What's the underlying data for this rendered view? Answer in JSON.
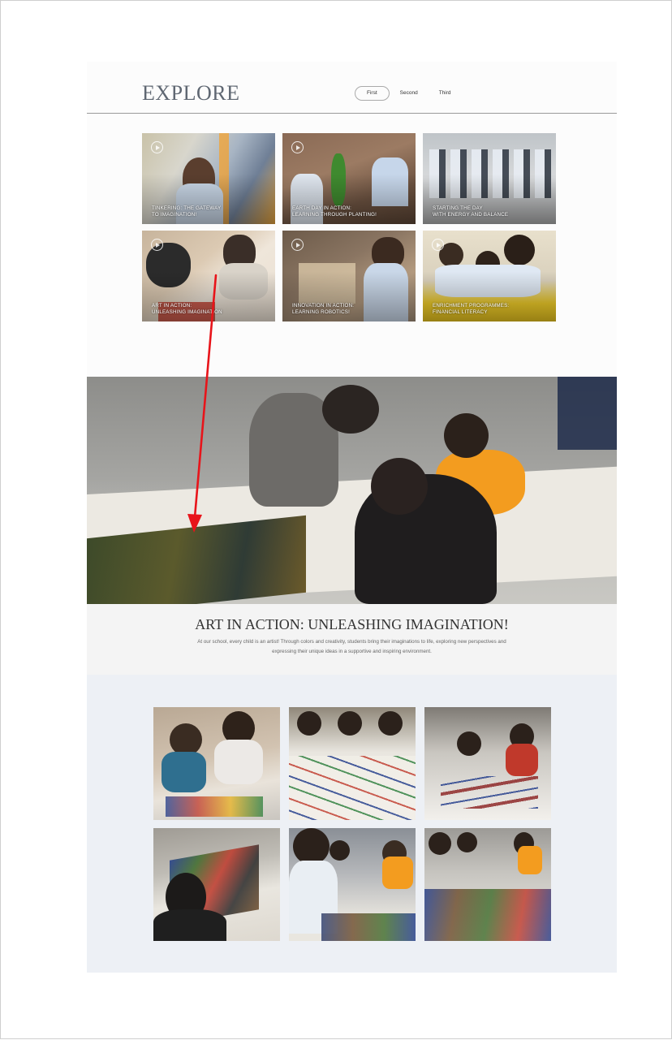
{
  "header": {
    "title": "EXPLORE",
    "tabs": [
      {
        "label": "First",
        "active": true
      },
      {
        "label": "Second",
        "active": false
      },
      {
        "label": "Third",
        "active": false
      }
    ]
  },
  "cards": [
    {
      "line1": "TINKERING: THE GATEWAY",
      "line2": "TO IMAGINATION!",
      "icon": "play-icon"
    },
    {
      "line1": "EARTH DAY IN ACTION:",
      "line2": "LEARNING THROUGH PLANTING!",
      "icon": "play-icon"
    },
    {
      "line1": "STARTING THE DAY",
      "line2": "WITH ENERGY AND BALANCE",
      "icon": "play-icon"
    },
    {
      "line1": "ART IN ACTION:",
      "line2": "UNLEASHING IMAGINATION",
      "icon": "play-icon"
    },
    {
      "line1": "INNOVATION IN ACTION:",
      "line2": "LEARNING ROBOTICS!",
      "icon": "play-icon"
    },
    {
      "line1": "ENRICHMENT PROGRAMMES:",
      "line2": "FINANCIAL LITERACY",
      "icon": "play-icon"
    }
  ],
  "feature": {
    "title": "ART IN ACTION: UNLEASHING IMAGINATION!",
    "description": "At our school, every child is an artist! Through colors and creativity, students bring their imaginations to life, exploring new perspectives and expressing their unique ideas in a supportive and inspiring environment."
  },
  "annotation": {
    "color": "#e8141a",
    "icon": "red-arrow-annotation"
  },
  "colors": {
    "accent_text": "#5f6772",
    "gallery_bg": "#edf0f5",
    "hero_text_bg": "#f4f4f4"
  }
}
